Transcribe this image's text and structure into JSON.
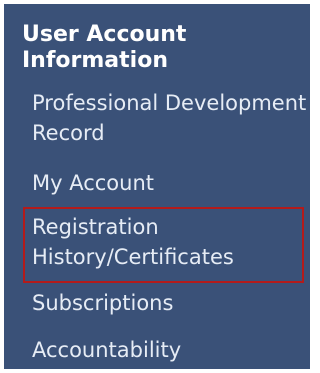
{
  "sidebar": {
    "heading": "User Account Information",
    "items": [
      {
        "label": "Professional Development Record"
      },
      {
        "label": "My Account"
      },
      {
        "label": "Registration History/Certificates",
        "highlighted": true
      },
      {
        "label": "Subscriptions"
      },
      {
        "label": "Accountability"
      }
    ],
    "colors": {
      "panel_background": "#3a5178",
      "heading_text": "#ffffff",
      "item_text": "#e6ecf5",
      "highlight_border": "#b31b1b"
    }
  }
}
